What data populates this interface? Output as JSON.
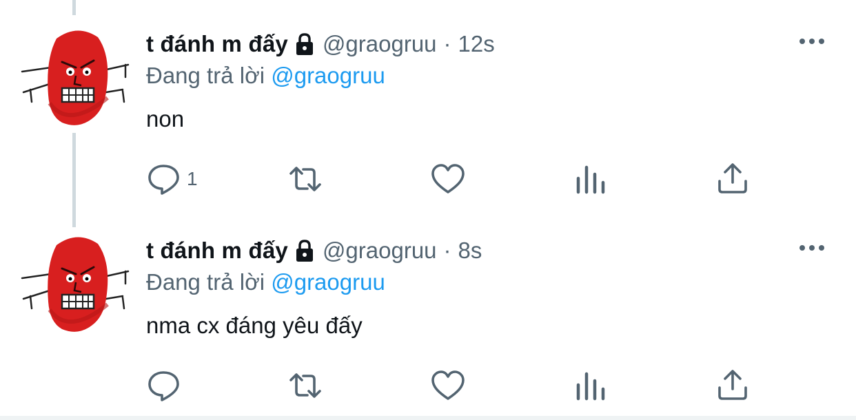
{
  "tweets": [
    {
      "display_name": "t đánh m đấy",
      "handle": "@graogruu",
      "separator": "·",
      "time": "12s",
      "reply_prefix": "Đang trả lời",
      "reply_mention": "@graogruu",
      "text": "non",
      "reply_count": "1",
      "icons": [
        "lock-icon",
        "more-icon",
        "reply-icon",
        "retweet-icon",
        "like-icon",
        "views-icon",
        "share-icon"
      ]
    },
    {
      "display_name": "t đánh m đấy",
      "handle": "@graogruu",
      "separator": "·",
      "time": "8s",
      "reply_prefix": "Đang trả lời",
      "reply_mention": "@graogruu",
      "text": "nma cx đáng yêu đấy",
      "reply_count": "",
      "icons": [
        "lock-icon",
        "more-icon",
        "reply-icon",
        "retweet-icon",
        "like-icon",
        "views-icon",
        "share-icon"
      ]
    }
  ],
  "colors": {
    "text_primary": "#0f1419",
    "text_secondary": "#536471",
    "accent": "#1d9bf0",
    "avatar_red": "#d81f1f",
    "thread_line": "#cfd9de"
  }
}
